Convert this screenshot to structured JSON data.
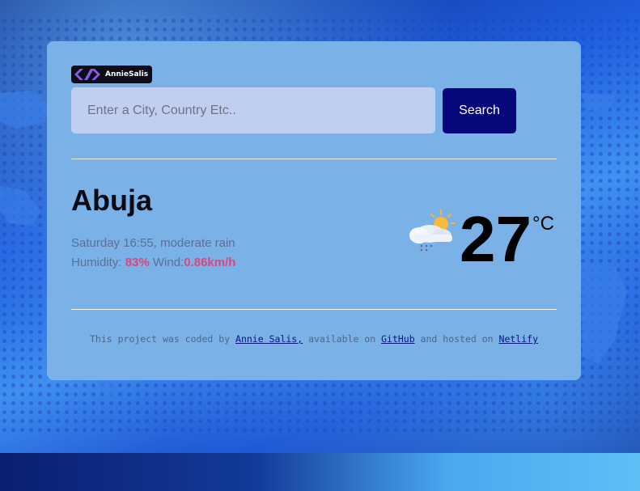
{
  "brand": {
    "logo_text": "AnnieSalis",
    "logo_icon": "code-bracket-logo-icon"
  },
  "search": {
    "placeholder": "Enter a City, Country Etc..",
    "value": "",
    "button_label": "Search"
  },
  "weather": {
    "city": "Abuja",
    "date_time": "Saturday 16:55",
    "description": "moderate rain",
    "humidity_label": "Humidity:",
    "humidity_value": "83%",
    "wind_label": "Wind:",
    "wind_value": "0.86km/h",
    "temperature": "27",
    "unit": "°C",
    "icon": "sun-behind-rain-cloud-icon"
  },
  "footer": {
    "text_1": "This project was coded by",
    "author_link": "Annie Salis,",
    "text_2": "available on",
    "github_link": "GitHub",
    "text_3": "and hosted on",
    "netlify_link": "Netlify"
  },
  "colors": {
    "card": "#7ab2e8",
    "button": "#06077a",
    "accent": "#e0437a"
  }
}
